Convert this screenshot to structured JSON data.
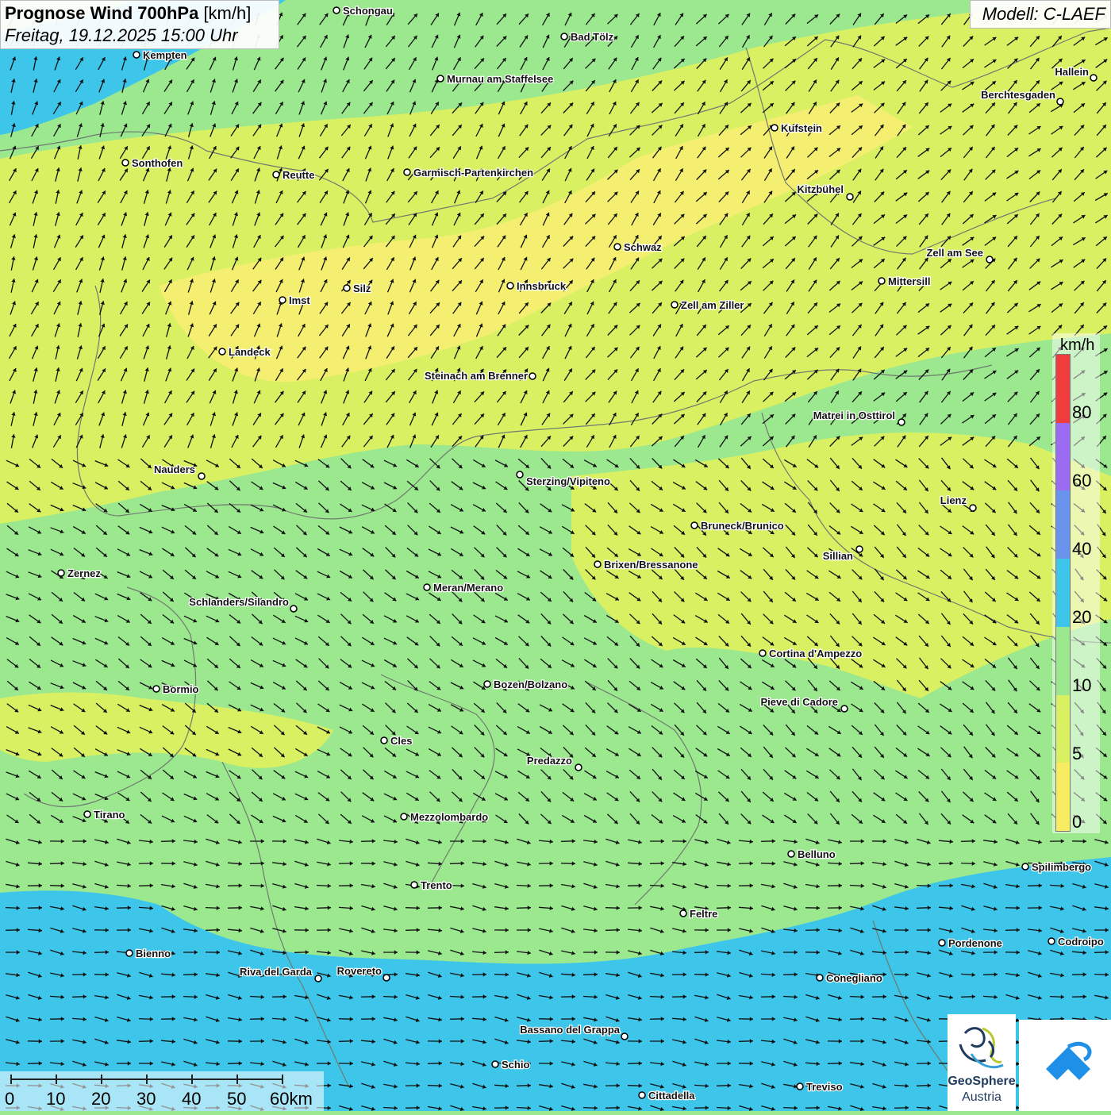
{
  "title": {
    "main": "Prognose Wind 700hPa",
    "unit": "[km/h]",
    "date": "Freitag, 19.12.2025 15:00 Uhr"
  },
  "model": "Modell: C-LAEF",
  "legend": {
    "unit": "km/h",
    "ticks": [
      "0",
      "5",
      "10",
      "20",
      "40",
      "60",
      "80"
    ],
    "colors": [
      "#f8ec60",
      "#d8f062",
      "#9be88f",
      "#3ec5ea",
      "#6a93ee",
      "#9b6cf2",
      "#f03c3c"
    ]
  },
  "colors": {
    "calm": "#f4ef70",
    "light": "#d8f062",
    "moderate": "#9be88f",
    "fresh": "#3ec5ea",
    "arrow": "#111111",
    "city_ring": "#ffffff"
  },
  "scale": {
    "labels": [
      "0",
      "10",
      "20",
      "30",
      "40",
      "50",
      "60km"
    ]
  },
  "logos": {
    "geosphere_line1": "GeoSphere",
    "geosphere_line2": "Austria",
    "app_icon": "wind-app-icon"
  },
  "cities": [
    {
      "name": "Schongau"
    },
    {
      "name": "Bad Tölz"
    },
    {
      "name": "Kempten"
    },
    {
      "name": "Murnau am Staffelsee"
    },
    {
      "name": "Hallein"
    },
    {
      "name": "Berchtesgaden"
    },
    {
      "name": "Kufstein"
    },
    {
      "name": "Sonthofen"
    },
    {
      "name": "Reutte"
    },
    {
      "name": "Garmisch-Partenkirchen"
    },
    {
      "name": "Kitzbühel"
    },
    {
      "name": "Schwaz"
    },
    {
      "name": "Zell am See"
    },
    {
      "name": "Innsbruck"
    },
    {
      "name": "Silz"
    },
    {
      "name": "Mittersill"
    },
    {
      "name": "Imst"
    },
    {
      "name": "Zell am Ziller"
    },
    {
      "name": "Landeck"
    },
    {
      "name": "Steinach am Brenner"
    },
    {
      "name": "Matrei in Osttirol"
    },
    {
      "name": "Nauders"
    },
    {
      "name": "Sterzing/Vipiteno"
    },
    {
      "name": "Lienz"
    },
    {
      "name": "Bruneck/Brunico"
    },
    {
      "name": "Sillian"
    },
    {
      "name": "Zernez"
    },
    {
      "name": "Brixen/Bressanone"
    },
    {
      "name": "Meran/Merano"
    },
    {
      "name": "Schlanders/Silandro"
    },
    {
      "name": "Cortina d'Ampezzo"
    },
    {
      "name": "Bozen/Bolzano"
    },
    {
      "name": "Bormio"
    },
    {
      "name": "Pieve di Cadore"
    },
    {
      "name": "Cles"
    },
    {
      "name": "Predazzo"
    },
    {
      "name": "Tirano"
    },
    {
      "name": "Mezzolombardo"
    },
    {
      "name": "Belluno"
    },
    {
      "name": "Spilimbergo"
    },
    {
      "name": "Trento"
    },
    {
      "name": "Feltre"
    },
    {
      "name": "Bienno"
    },
    {
      "name": "Pordenone"
    },
    {
      "name": "Codroipo"
    },
    {
      "name": "Riva del Garda"
    },
    {
      "name": "Rovereto"
    },
    {
      "name": "Conegliano"
    },
    {
      "name": "Bassano del Grappa"
    },
    {
      "name": "Schio"
    },
    {
      "name": "Treviso"
    },
    {
      "name": "Cittadella"
    }
  ]
}
